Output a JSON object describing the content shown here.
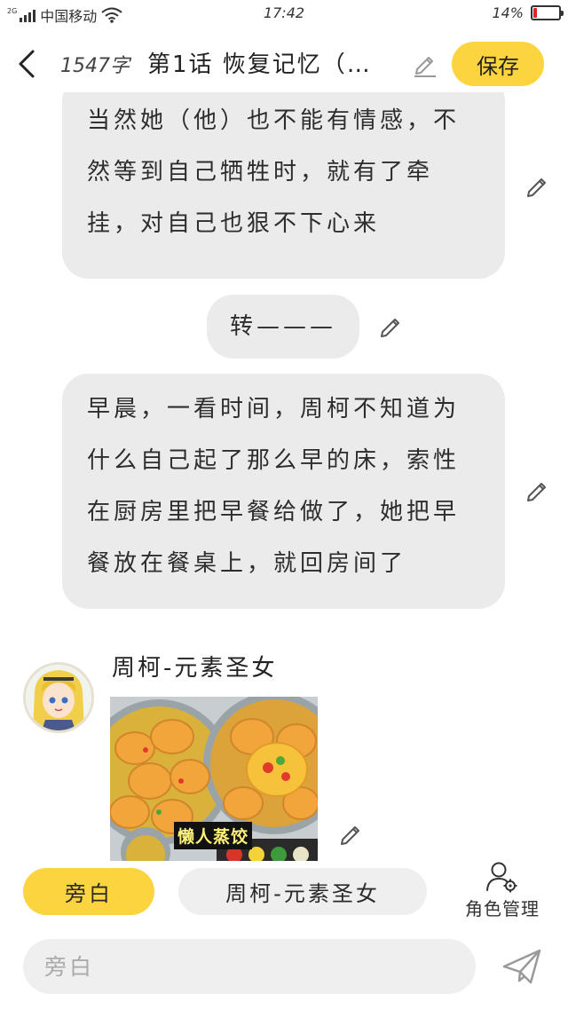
{
  "status_bar": {
    "network": "2G",
    "carrier": "中国移动",
    "time": "17:42",
    "battery_text": "14%",
    "battery_level": 0.14,
    "battery_color": "#e02525"
  },
  "header": {
    "word_count": "1547字",
    "chapter_title": "第1话  恢复记忆（…",
    "save_label": "保存",
    "icons": {
      "back": "chevron-left-icon",
      "edit": "pencil-icon"
    }
  },
  "messages": [
    {
      "type": "narration",
      "text": "当然她（他）也不能有情感，不然等到自己牺牲时，就有了牵挂，对自己也狠不下心来"
    },
    {
      "type": "narration",
      "text": "转———"
    },
    {
      "type": "narration",
      "text": "早晨，一看时间，周柯不知道为什么自己起了那么早的床，索性在厨房里把早餐给做了，她把早餐放在餐桌上，就回房间了"
    },
    {
      "type": "character",
      "speaker": "周柯-元素圣女",
      "image_caption": "懒人蒸饺"
    }
  ],
  "role_bar": {
    "narration_label": "旁白",
    "character_label": "周柯-元素圣女",
    "manage_label": "角色管理"
  },
  "input": {
    "placeholder": "旁白",
    "value": ""
  },
  "colors": {
    "accent": "#fcd43f",
    "bubble": "#ebebeb",
    "chip_inactive": "#efefef"
  }
}
